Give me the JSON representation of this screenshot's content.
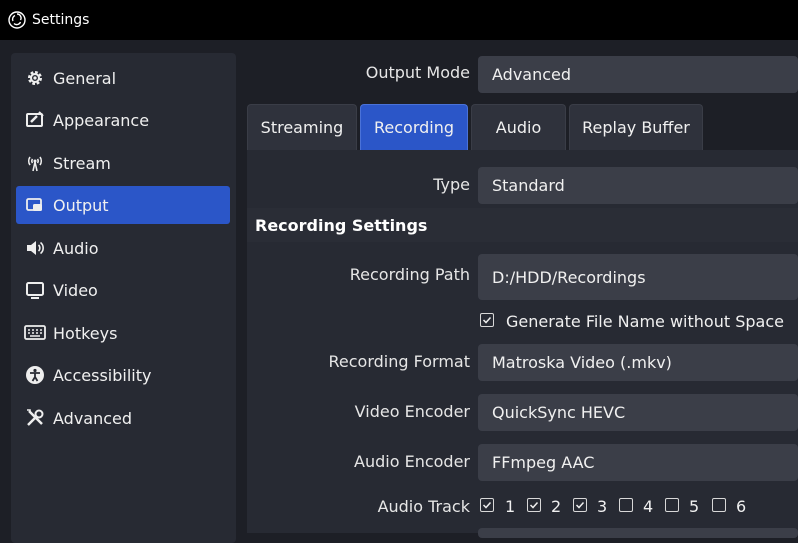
{
  "window": {
    "title": "Settings",
    "icon": "obs-logo-icon"
  },
  "sidebar": {
    "items": [
      {
        "label": "General",
        "icon": "gear-icon",
        "active": false
      },
      {
        "label": "Appearance",
        "icon": "appearance-icon",
        "active": false
      },
      {
        "label": "Stream",
        "icon": "antenna-icon",
        "active": false
      },
      {
        "label": "Output",
        "icon": "output-icon",
        "active": true
      },
      {
        "label": "Audio",
        "icon": "speaker-icon",
        "active": false
      },
      {
        "label": "Video",
        "icon": "monitor-icon",
        "active": false
      },
      {
        "label": "Hotkeys",
        "icon": "keyboard-icon",
        "active": false
      },
      {
        "label": "Accessibility",
        "icon": "accessibility-icon",
        "active": false
      },
      {
        "label": "Advanced",
        "icon": "tools-icon",
        "active": false
      }
    ]
  },
  "output_mode": {
    "label": "Output Mode",
    "value": "Advanced"
  },
  "tabs": [
    {
      "label": "Streaming",
      "active": false
    },
    {
      "label": "Recording",
      "active": true
    },
    {
      "label": "Audio",
      "active": false
    },
    {
      "label": "Replay Buffer",
      "active": false
    }
  ],
  "type": {
    "label": "Type",
    "value": "Standard"
  },
  "recording": {
    "section_title": "Recording Settings",
    "path": {
      "label": "Recording Path",
      "value": "D:/HDD/Recordings"
    },
    "generate_filename": {
      "label": "Generate File Name without Space",
      "checked": true
    },
    "format": {
      "label": "Recording Format",
      "value": "Matroska Video (.mkv)"
    },
    "video_encoder": {
      "label": "Video Encoder",
      "value": "QuickSync HEVC"
    },
    "audio_encoder": {
      "label": "Audio Encoder",
      "value": "FFmpeg AAC"
    },
    "audio_track": {
      "label": "Audio Track",
      "tracks": [
        {
          "label": "1",
          "checked": true
        },
        {
          "label": "2",
          "checked": true
        },
        {
          "label": "3",
          "checked": true
        },
        {
          "label": "4",
          "checked": false
        },
        {
          "label": "5",
          "checked": false
        },
        {
          "label": "6",
          "checked": false
        }
      ]
    }
  },
  "colors": {
    "accent": "#2b56c8",
    "field": "#3b3e48",
    "panel": "#272a33",
    "background": "#1d1f26"
  }
}
